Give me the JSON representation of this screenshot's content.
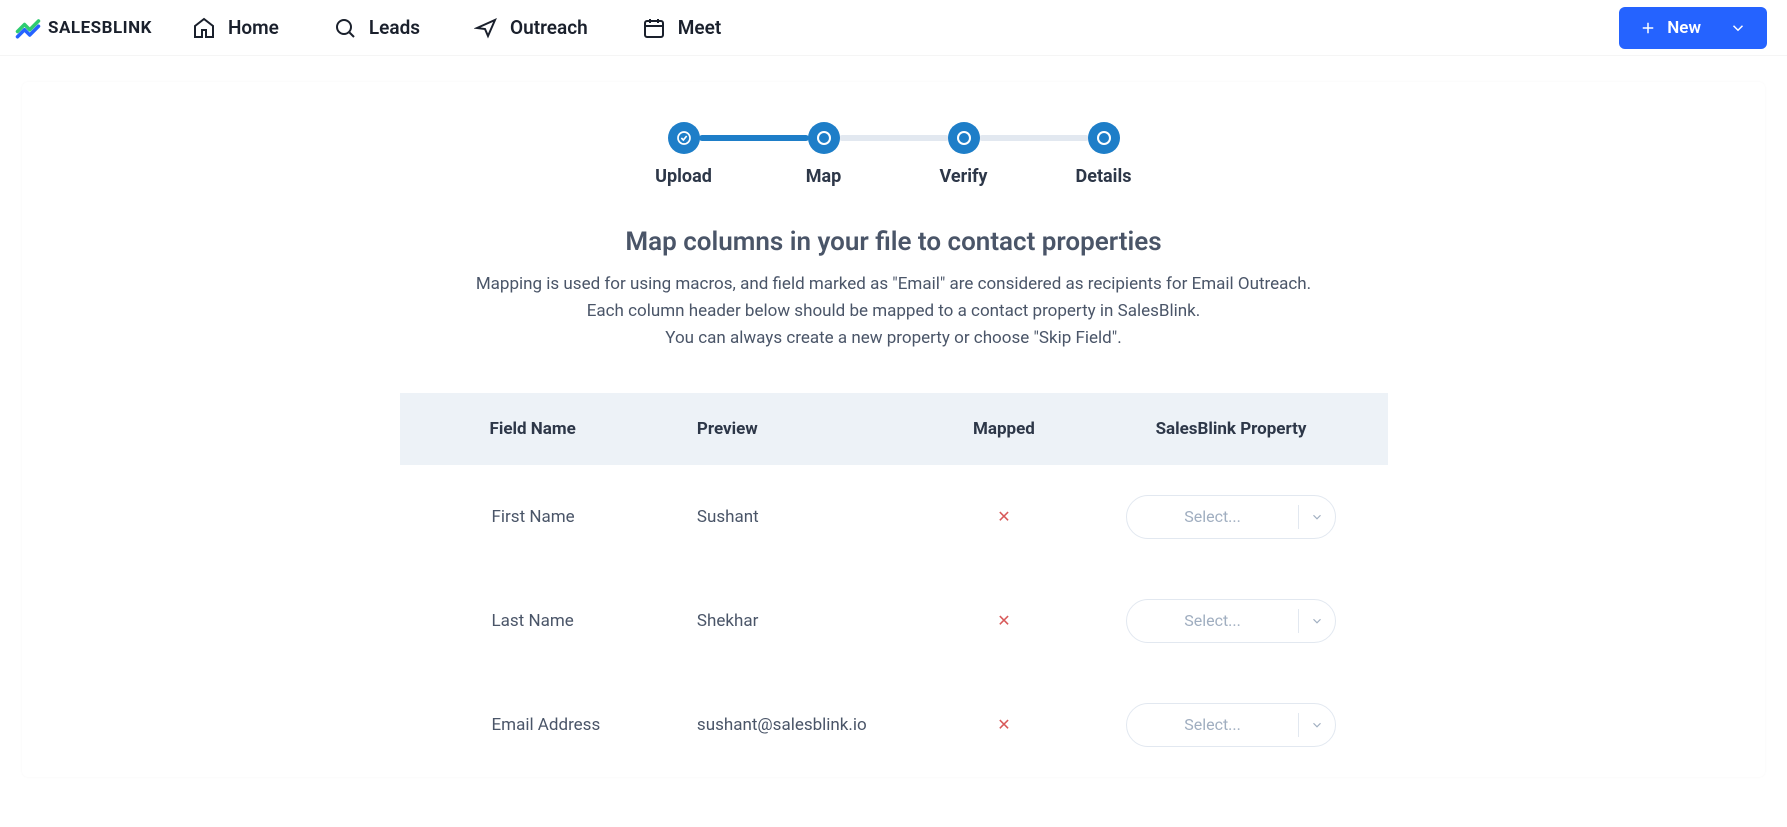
{
  "brand": {
    "name": "SALESBLINK"
  },
  "nav": {
    "items": [
      {
        "label": "Home",
        "icon": "home-icon"
      },
      {
        "label": "Leads",
        "icon": "search-icon"
      },
      {
        "label": "Outreach",
        "icon": "send-icon"
      },
      {
        "label": "Meet",
        "icon": "calendar-icon"
      }
    ],
    "new_button": "New"
  },
  "stepper": {
    "steps": [
      {
        "label": "Upload",
        "state": "done"
      },
      {
        "label": "Map",
        "state": "active"
      },
      {
        "label": "Verify",
        "state": "pending"
      },
      {
        "label": "Details",
        "state": "pending"
      }
    ]
  },
  "heading": {
    "title": "Map columns in your file to contact properties",
    "line1": "Mapping is used for using macros, and field marked as \"Email\" are considered as recipients for Email Outreach.",
    "line2": "Each column header below should be mapped to a contact property in SalesBlink.",
    "line3": "You can always create a new property or choose \"Skip Field\"."
  },
  "table": {
    "columns": [
      "Field Name",
      "Preview",
      "Mapped",
      "SalesBlink Property"
    ],
    "select_placeholder": "Select...",
    "rows": [
      {
        "field": "First Name",
        "preview": "Sushant",
        "mapped": false
      },
      {
        "field": "Last Name",
        "preview": "Shekhar",
        "mapped": false
      },
      {
        "field": "Email Address",
        "preview": "sushant@salesblink.io",
        "mapped": false
      }
    ]
  }
}
